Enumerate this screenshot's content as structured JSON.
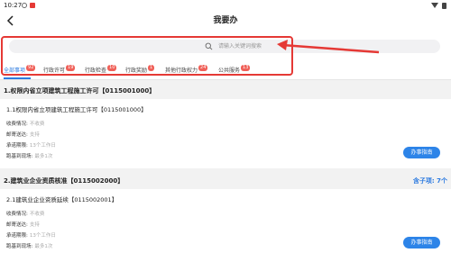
{
  "status_bar": {
    "time": "10:27"
  },
  "header": {
    "title": "我要办"
  },
  "search": {
    "placeholder": "请输入关键词搜索"
  },
  "tabs": [
    {
      "label": "全部事项",
      "badge": "92"
    },
    {
      "label": "行政许可",
      "badge": "19"
    },
    {
      "label": "行政检查",
      "badge": "10"
    },
    {
      "label": "行政奖励",
      "badge": "1"
    },
    {
      "label": "其他行政权力",
      "badge": "24"
    },
    {
      "label": "公共服务",
      "badge": "13"
    }
  ],
  "sections": [
    {
      "title": "1.权限内省立项建筑工程施工许可【0115001000】",
      "item": {
        "title": "1.1权限内省立项建筑工程施工许可【0115001000】",
        "fields": [
          {
            "label": "收费情况:",
            "value": "不收费"
          },
          {
            "label": "邮寄送达:",
            "value": "支持"
          },
          {
            "label": "承诺期限:",
            "value": "13个工作日"
          },
          {
            "label": "跑基到现场:",
            "value": "最多1次"
          }
        ],
        "button": "办事指南"
      }
    },
    {
      "title": "2.建筑业企业资质核准【0115002000】",
      "sub_count": "含子项: 7个",
      "item": {
        "title": "2.1建筑业企业资质延续【0115002001】",
        "fields": [
          {
            "label": "收费情况:",
            "value": "不收费"
          },
          {
            "label": "邮寄送达:",
            "value": "支持"
          },
          {
            "label": "承诺期限:",
            "value": "13个工作日"
          },
          {
            "label": "跑基到现场:",
            "value": "最多1次"
          }
        ],
        "button": "办事指南"
      }
    }
  ],
  "colors": {
    "accent": "#2d7be0",
    "badge": "#f06058",
    "highlight": "#e53935"
  }
}
